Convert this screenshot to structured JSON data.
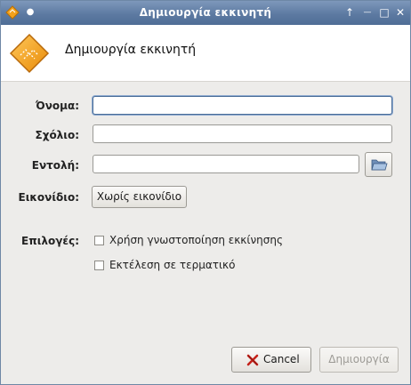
{
  "window": {
    "title": "Δημιουργία εκκινητή",
    "controls": {
      "shade": "↑",
      "minimize": "—",
      "maximize": "□",
      "close": "✕"
    }
  },
  "header": {
    "title": "Δημιουργία εκκινητή",
    "icon": "launcher-diamond-icon"
  },
  "form": {
    "name_label": "Όνομα:",
    "name_value": "",
    "comment_label": "Σχόλιο:",
    "comment_value": "",
    "command_label": "Εντολή:",
    "command_value": "",
    "icon_label": "Εικονίδιο:",
    "icon_button": "Χωρίς εικονίδιο",
    "options_label": "Επιλογές:",
    "options": [
      {
        "label": "Χρήση γνωστοποίηση εκκίνησης",
        "checked": false
      },
      {
        "label": "Εκτέλεση σε τερματικό",
        "checked": false
      }
    ]
  },
  "footer": {
    "cancel_label": "Cancel",
    "create_label": "Δημιουργία"
  },
  "colors": {
    "titlebar": "#5d7aa2",
    "accent_orange": "#f0a020",
    "focus": "#4b6e98"
  }
}
